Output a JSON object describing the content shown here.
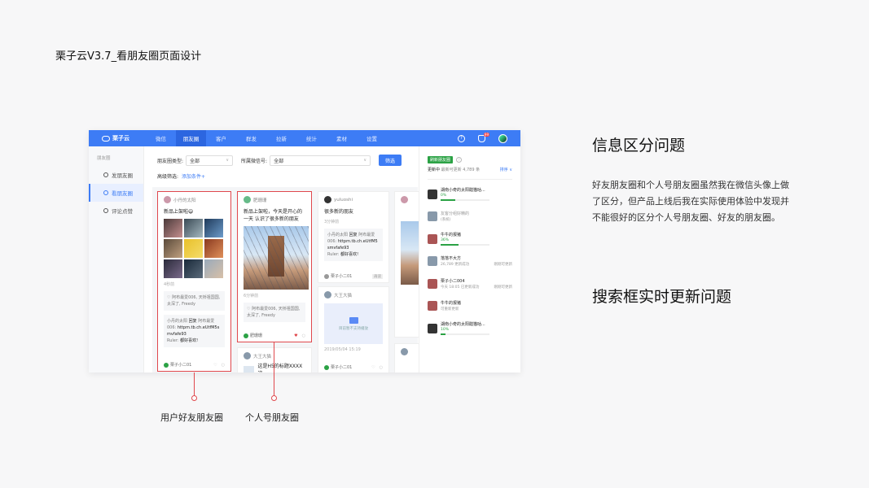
{
  "page_title": "栗子云V3.7_看朋友圈页面设计",
  "app": {
    "logo": "栗子云",
    "nav": [
      "微信",
      "朋友圈",
      "客户",
      "群发",
      "拉新",
      "统计",
      "素材",
      "设置"
    ],
    "active_nav": 1,
    "notif_badge": "99",
    "sidebar": {
      "heading": "朋友圈",
      "items": [
        "发朋友圈",
        "看朋友圈",
        "评论点赞"
      ],
      "active": 1
    },
    "filters": {
      "type_label": "朋友圈类型:",
      "type_value": "全部",
      "account_label": "所属微信号:",
      "account_value": "全部",
      "filter_button": "筛选",
      "advanced_label": "高级筛选:",
      "add_condition": "添加条件+"
    },
    "cards": {
      "c1": {
        "name": "小丹的太阳",
        "text": "新品上架啦😄",
        "time": "4秒前",
        "comment1": "♡ 阿布最爱006, 天桥祖国国, 太深了, Freedy",
        "comment2_user": "小丹的太阳",
        "comment2_reply": "回复",
        "comment2_target": "阿布最爱006:",
        "comment2_text": "httpm.tb.ch.eUtfM5smvfafe93",
        "comment3_user": "Ruler:",
        "comment3_text": "都好喜欢!",
        "owner": "栗子小二01"
      },
      "c2": {
        "name": "肥珊珊",
        "text": "新品上架啦，今天是开心的一天 认识了很多新的朋友",
        "time": "6分钟前",
        "comment1": "♡ 阿布最爱006, 天桥祖国国, 太深了, Freedy",
        "owner": "肥珊珊"
      },
      "c3": {
        "name": "yuluoshi",
        "text": "很多新的朋友",
        "time": "3分钟前",
        "comment1_user": "小丹的太阳",
        "comment1_reply": "回复",
        "comment1_target": "阿布最爱006:",
        "comment1_text": "httpm.tb.ch.eUtfM5smvfafe93",
        "comment2_user": "Ruler:",
        "comment2_text": "都好喜欢!",
        "owner": "栗子小二01",
        "tag": "再读"
      },
      "c4": {
        "name": "大王大猫",
        "video_hint": "目前暂不支持播放",
        "date": "2019/05/04 15:19",
        "owner": "栗子小二01"
      },
      "c5": {
        "name": "大王大猫",
        "text": "这是H5的标题XXXX这"
      }
    },
    "right_panel": {
      "update_button": "刷新朋友圈",
      "update_label": "更新中",
      "update_info": "最新可更新 4,789 条",
      "sort": "排序 ∨",
      "items": [
        {
          "name": "湖南小奇的太阳醋猫咕...",
          "sub": "0%",
          "progress": 0.3,
          "side": ""
        },
        {
          "name": "友客分组好精的",
          "sub": "(系统)",
          "progress": null,
          "side": ""
        },
        {
          "name": "牛牛的报猪",
          "sub": "36%",
          "progress": 0.36,
          "side": ""
        },
        {
          "name": "落落不大方",
          "sub": "26,789 更新成功",
          "progress": null,
          "side": "刚刚可更新"
        },
        {
          "name": "栗子小二004",
          "sub": "今天 18:05 已更新成功",
          "progress": null,
          "side": "刚刚可更新"
        },
        {
          "name": "牛牛的报猪",
          "sub": "可重新更新",
          "progress": null,
          "side": ""
        },
        {
          "name": "湖南小奇的太阳醋猫咕...",
          "sub": "10%",
          "progress": 0.1,
          "side": ""
        }
      ]
    }
  },
  "callouts": {
    "left": "用户好友朋友圈",
    "right": "个人号朋友圈"
  },
  "issues": {
    "title1": "信息区分问题",
    "desc1": "好友朋友圈和个人号朋友圈虽然我在微信头像上做了区分，但产品上线后我在实际使用体验中发现并不能很好的区分个人号朋友圈、好友的朋友圈。",
    "title2": "搜索框实时更新问题"
  }
}
